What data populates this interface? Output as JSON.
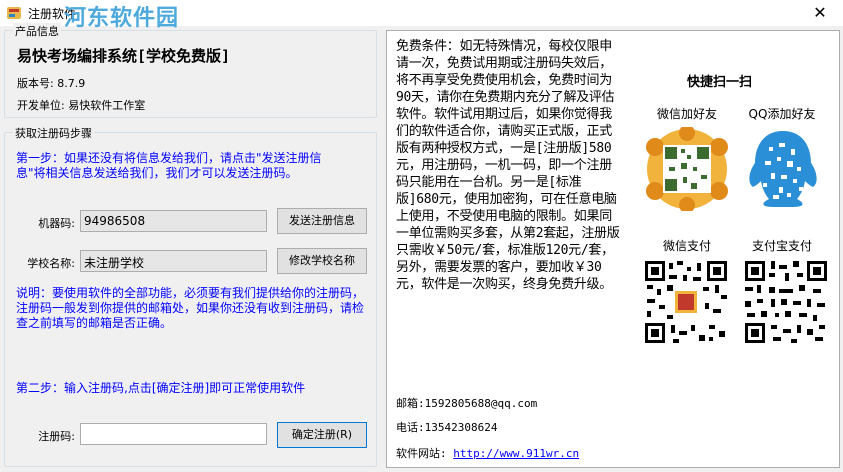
{
  "window": {
    "title": "注册软件",
    "watermark": "河东软件园",
    "close_glyph": "✕"
  },
  "info_group": {
    "legend": "产品信息",
    "product_name": "易快考场编排系统[学校免费版]",
    "version": "版本号: 8.7.9",
    "developer": "开发单位: 易快软件工作室"
  },
  "steps_group": {
    "legend": "获取注册码步骤",
    "step1": "第一步：如果还没有将信息发给我们，请点击\"发送注册信息\"将相关信息发送给我们，我们才可以发送注册码。",
    "machine_code_label": "机器码:",
    "machine_code_value": "94986508",
    "send_info_button": "发送注册信息",
    "school_name_label": "学校名称:",
    "school_name_value": "未注册学校",
    "modify_school_button": "修改学校名称",
    "note": "说明：要使用软件的全部功能，必须要有我们提供给你的注册码，注册码一般发到你提供的邮箱处，如果你还没有收到注册码，请检查之前填写的邮箱是否正确。",
    "step2": "第二步：输入注册码,点击[确定注册]即可正常使用软件",
    "reg_code_label": "注册码:",
    "reg_code_value": "",
    "confirm_button": "确定注册(R)"
  },
  "terms": {
    "text": "免费条件：如无特殊情况，每校仅限申请一次，免费试用期或注册码失效后，将不再享受免费使用机会，免费时间为90天，请你在免费期内充分了解及评估软件。软件试用期过后，如果你觉得我们的软件适合你，请购买正式版，正式版有两种授权方式，一是[注册版]580元，用注册码，一机一码，即一个注册码只能用在一台机。另一是[标准版]680元，使用加密狗，可在任意电脑上使用，不受使用电脑的限制。如果同一单位需购买多套，从第2套起，注册版只需收￥50元/套，标准版120元/套，另外，需要发票的客户，要加收￥30元，软件是一次购买，终身免费升级。"
  },
  "contact": {
    "email": "邮箱:1592805688@qq.com",
    "phone": "电话:13542308624",
    "website_label": "软件网站: ",
    "website_url": "http://www.911wr.cn"
  },
  "qr": {
    "title": "快捷扫一扫",
    "wechat_add": "微信加好友",
    "qq_add": "QQ添加好友",
    "wechat_pay": "微信支付",
    "alipay": "支付宝支付"
  },
  "colors": {
    "instruction_text": "#0000ff",
    "link": "#0000ff",
    "watermark": "#4ea9dd",
    "focus_border": "#0078d7"
  }
}
